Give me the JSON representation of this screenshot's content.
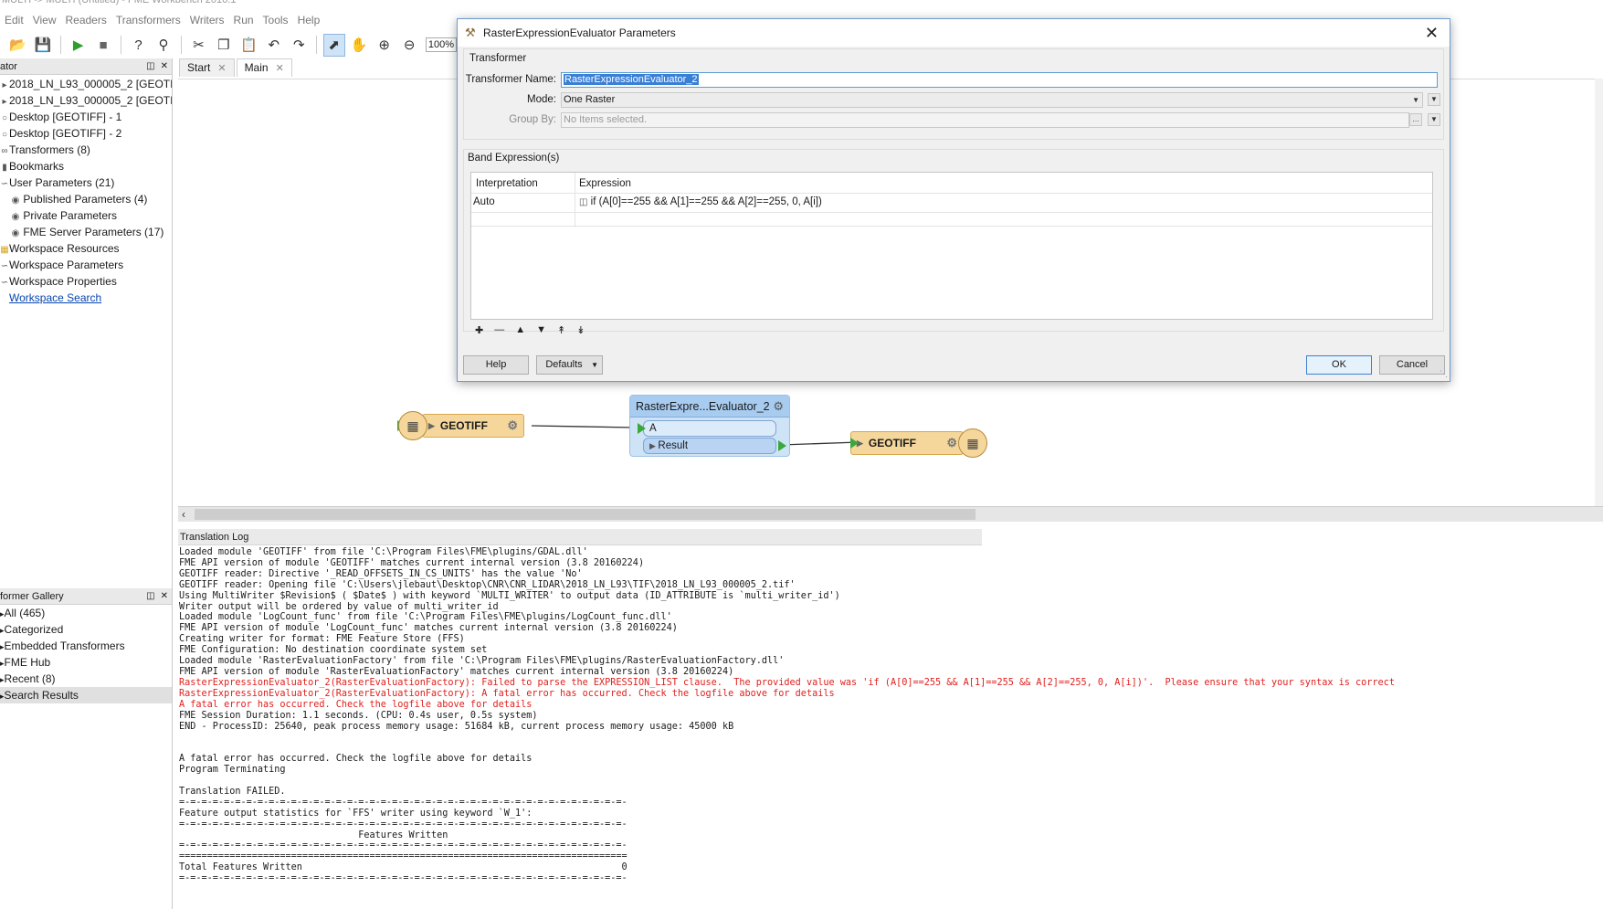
{
  "window": {
    "title": "MULTI -> MULTI (Untitled) - FME Workbench 2016.1"
  },
  "menu": [
    "Edit",
    "View",
    "Readers",
    "Transformers",
    "Writers",
    "Run",
    "Tools",
    "Help"
  ],
  "toolbar": {
    "zoom": "100%"
  },
  "navigator": {
    "title": "ator",
    "items": [
      {
        "label": "2018_LN_L93_000005_2 [GEOTIF...",
        "icon": "reader-icon"
      },
      {
        "label": "2018_LN_L93_000005_2 [GEOTIF...",
        "icon": "writer-icon"
      },
      {
        "label": "Desktop [GEOTIFF] - 1",
        "icon": "reader-icon"
      },
      {
        "label": "Desktop [GEOTIFF] - 2",
        "icon": "writer-icon"
      },
      {
        "label": "Transformers (8)",
        "icon": "transformer-icon"
      },
      {
        "label": "Bookmarks",
        "icon": "bookmark-icon"
      },
      {
        "label": "User Parameters (21)",
        "icon": "parameters-icon"
      },
      {
        "label": "Published Parameters (4)",
        "icon": "parameters-icon",
        "indent": true
      },
      {
        "label": "Private Parameters",
        "icon": "parameters-icon",
        "indent": true
      },
      {
        "label": "FME Server Parameters (17)",
        "icon": "parameters-icon",
        "indent": true
      },
      {
        "label": "Workspace Resources",
        "icon": "folder-icon"
      },
      {
        "label": "Workspace Parameters",
        "icon": "parameters-icon"
      },
      {
        "label": "Workspace Properties",
        "icon": "properties-icon"
      },
      {
        "label": "Workspace Search",
        "icon": "search-icon",
        "link": true
      }
    ]
  },
  "gallery": {
    "title": "former Gallery",
    "items": [
      "All (465)",
      "Categorized",
      "Embedded Transformers",
      "FME Hub",
      "Recent (8)",
      "Search Results"
    ]
  },
  "tabs": [
    {
      "label": "Start"
    },
    {
      "label": "Main"
    }
  ],
  "canvas": {
    "reader_node": "GEOTIFF",
    "transformer_node": "RasterExpre...Evaluator_2",
    "port_in": "A",
    "port_out": "Result",
    "writer_node": "GEOTIFF"
  },
  "log": {
    "title": "Translation Log",
    "lines": [
      {
        "t": "Loaded module 'GEOTIFF' from file 'C:\\Program Files\\FME\\plugins/GDAL.dll'",
        "e": false
      },
      {
        "t": "FME API version of module 'GEOTIFF' matches current internal version (3.8 20160224)",
        "e": false
      },
      {
        "t": "GEOTIFF reader: Directive '_READ_OFFSETS_IN_CS_UNITS' has the value 'No'",
        "e": false
      },
      {
        "t": "GEOTIFF reader: Opening file 'C:\\Users\\jlebaut\\Desktop\\CNR\\CNR_LIDAR\\2018_LN_L93\\TIF\\2018_LN_L93_000005_2.tif'",
        "e": false
      },
      {
        "t": "Using MultiWriter $Revision$ ( $Date$ ) with keyword `MULTI_WRITER' to output data (ID_ATTRIBUTE is `multi_writer_id')",
        "e": false
      },
      {
        "t": "Writer output will be ordered by value of multi_writer_id",
        "e": false
      },
      {
        "t": "Loaded module 'LogCount_func' from file 'C:\\Program Files\\FME\\plugins/LogCount_func.dll'",
        "e": false
      },
      {
        "t": "FME API version of module 'LogCount_func' matches current internal version (3.8 20160224)",
        "e": false
      },
      {
        "t": "Creating writer for format: FME Feature Store (FFS)",
        "e": false
      },
      {
        "t": "FME Configuration: No destination coordinate system set",
        "e": false
      },
      {
        "t": "Loaded module 'RasterEvaluationFactory' from file 'C:\\Program Files\\FME\\plugins/RasterEvaluationFactory.dll'",
        "e": false
      },
      {
        "t": "FME API version of module 'RasterEvaluationFactory' matches current internal version (3.8 20160224)",
        "e": false
      },
      {
        "t": "RasterExpressionEvaluator_2(RasterEvaluationFactory): Failed to parse the EXPRESSION_LIST clause.  The provided value was 'if (A[0]==255 && A[1]==255 && A[2]==255, 0, A[i])'.  Please ensure that your syntax is correct",
        "e": true
      },
      {
        "t": "RasterExpressionEvaluator_2(RasterEvaluationFactory): A fatal error has occurred. Check the logfile above for details",
        "e": true
      },
      {
        "t": "A fatal error has occurred. Check the logfile above for details",
        "e": true
      },
      {
        "t": "FME Session Duration: 1.1 seconds. (CPU: 0.4s user, 0.5s system)",
        "e": false
      },
      {
        "t": "END - ProcessID: 25640, peak process memory usage: 51684 kB, current process memory usage: 45000 kB",
        "e": false
      },
      {
        "t": "",
        "e": false
      },
      {
        "t": "",
        "e": false
      },
      {
        "t": "A fatal error has occurred. Check the logfile above for details",
        "e": false
      },
      {
        "t": "Program Terminating",
        "e": false
      },
      {
        "t": "",
        "e": false
      },
      {
        "t": "Translation FAILED.",
        "e": false
      },
      {
        "t": "=-=-=-=-=-=-=-=-=-=-=-=-=-=-=-=-=-=-=-=-=-=-=-=-=-=-=-=-=-=-=-=-=-=-=-=-=-=-=-=-",
        "e": false
      },
      {
        "t": "Feature output statistics for `FFS' writer using keyword `W_1':",
        "e": false
      },
      {
        "t": "=-=-=-=-=-=-=-=-=-=-=-=-=-=-=-=-=-=-=-=-=-=-=-=-=-=-=-=-=-=-=-=-=-=-=-=-=-=-=-=-",
        "e": false
      },
      {
        "t": "                                Features Written",
        "e": false
      },
      {
        "t": "=-=-=-=-=-=-=-=-=-=-=-=-=-=-=-=-=-=-=-=-=-=-=-=-=-=-=-=-=-=-=-=-=-=-=-=-=-=-=-=-",
        "e": false
      },
      {
        "t": "================================================================================",
        "e": false
      },
      {
        "t": "Total Features Written                                                         0",
        "e": false
      },
      {
        "t": "=-=-=-=-=-=-=-=-=-=-=-=-=-=-=-=-=-=-=-=-=-=-=-=-=-=-=-=-=-=-=-=-=-=-=-=-=-=-=-=-",
        "e": false
      }
    ]
  },
  "dialog": {
    "title": "RasterExpressionEvaluator Parameters",
    "section_transformer": "Transformer",
    "name_label": "Transformer Name:",
    "name_value": "RasterExpressionEvaluator_2",
    "mode_label": "Mode:",
    "mode_value": "One Raster",
    "groupby_label": "Group By:",
    "groupby_placeholder": "No Items selected.",
    "section_bands": "Band Expression(s)",
    "col_interpretation": "Interpretation",
    "col_expression": "Expression",
    "rows": [
      {
        "interpretation": "Auto",
        "expression": "if (A[0]==255 && A[1]==255 && A[2]==255, 0, A[i])"
      }
    ],
    "help_label": "Help",
    "defaults_label": "Defaults",
    "ok_label": "OK",
    "cancel_label": "Cancel"
  }
}
